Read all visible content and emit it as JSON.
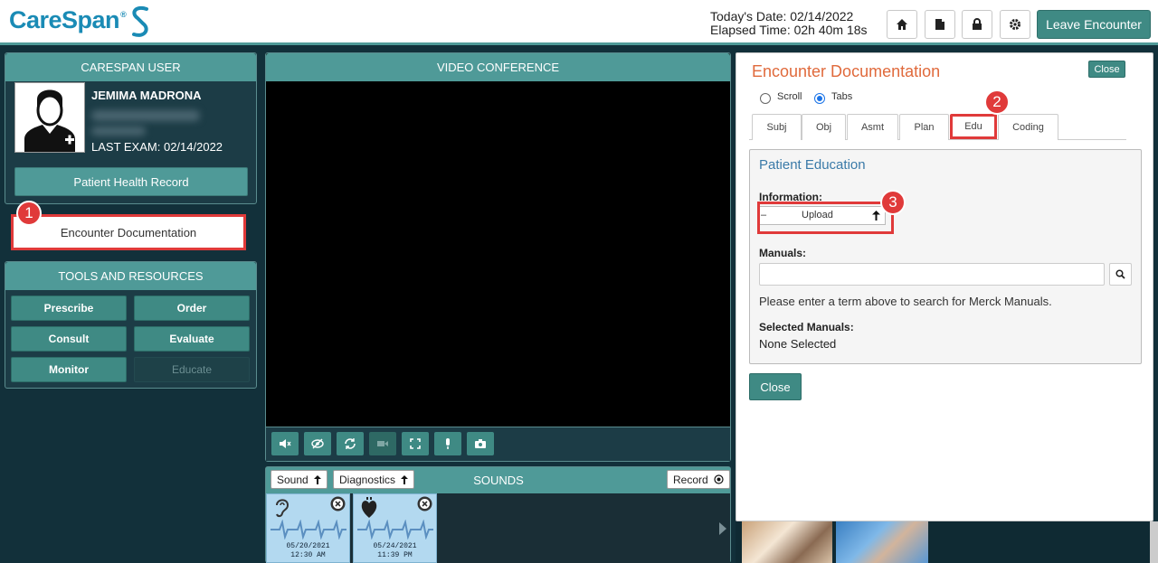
{
  "header": {
    "logo": "CareSpan",
    "logo_mark": "®",
    "todays_date": "Today's Date: 02/14/2022",
    "elapsed_time": "Elapsed Time: 02h 40m 18s",
    "icons": [
      "home-icon",
      "document-icon",
      "lock-icon",
      "gear-icon"
    ],
    "leave_label": "Leave Encounter"
  },
  "user_panel": {
    "title": "CARESPAN USER",
    "name": "JEMIMA MADRONA",
    "last_exam_label": "LAST EXAM:",
    "last_exam_date": "02/14/2022",
    "phr_label": "Patient Health Record"
  },
  "encounter_doc_label": "Encounter Documentation",
  "tools": {
    "title": "TOOLS AND RESOURCES",
    "buttons": [
      "Prescribe",
      "Order",
      "Consult",
      "Evaluate",
      "Monitor",
      "Educate"
    ]
  },
  "video": {
    "title": "VIDEO CONFERENCE",
    "controls": [
      "mute-icon",
      "hide-video-icon",
      "refresh-icon",
      "camera-icon",
      "fullscreen-icon",
      "microphone-icon",
      "snapshot-icon"
    ]
  },
  "sounds": {
    "sound_label": "Sound",
    "diagnostics_label": "Diagnostics",
    "title": "SOUNDS",
    "record_label": "Record",
    "cards": [
      {
        "icon": "ear-icon",
        "date": "05/20/2021",
        "time": "12:30 AM"
      },
      {
        "icon": "heart-icon",
        "date": "05/24/2021",
        "time": "11:39 PM"
      }
    ]
  },
  "modal": {
    "title": "Encounter Documentation",
    "close_label": "Close",
    "view_modes": [
      "Scroll",
      "Tabs"
    ],
    "selected_view": "Tabs",
    "tabs": [
      "Subj",
      "Obj",
      "Asmt",
      "Plan",
      "Edu",
      "Coding"
    ],
    "active_tab": "Edu",
    "section_title": "Patient Education",
    "information_label": "Information:",
    "upload_dash": "–",
    "upload_label": "Upload",
    "manuals_label": "Manuals:",
    "manuals_value": "",
    "manuals_hint": "Please enter a term above to search for Merck Manuals.",
    "selected_manuals_label": "Selected Manuals:",
    "selected_manuals_value": "None Selected",
    "bottom_close_label": "Close"
  },
  "callouts": [
    "1",
    "2",
    "3"
  ],
  "colors": {
    "accent": "#4f9a98",
    "button": "#3f8a84",
    "background": "#12303a",
    "highlight": "#e03a3a",
    "title_orange": "#e06a3c"
  }
}
